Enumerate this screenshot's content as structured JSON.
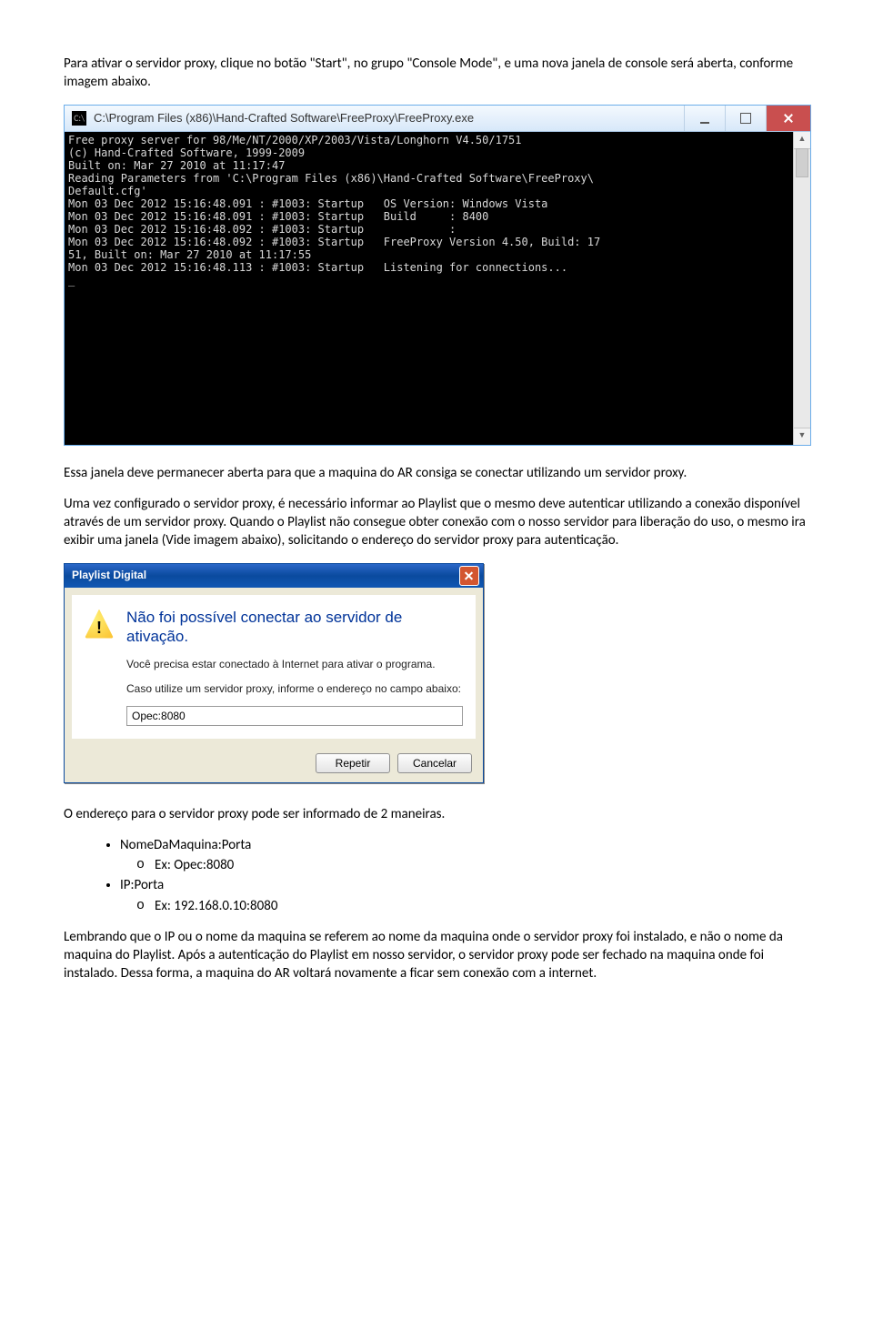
{
  "para1": "Para ativar o servidor proxy, clique no botão \"Start\", no grupo \"Console Mode\", e uma nova janela de console será aberta, conforme imagem abaixo.",
  "console": {
    "title": "C:\\Program Files (x86)\\Hand-Crafted Software\\FreeProxy\\FreeProxy.exe",
    "lines": "Free proxy server for 98/Me/NT/2000/XP/2003/Vista/Longhorn V4.50/1751\n(c) Hand-Crafted Software, 1999-2009\nBuilt on: Mar 27 2010 at 11:17:47\nReading Parameters from 'C:\\Program Files (x86)\\Hand-Crafted Software\\FreeProxy\\\nDefault.cfg'\nMon 03 Dec 2012 15:16:48.091 : #1003: Startup   OS Version: Windows Vista\nMon 03 Dec 2012 15:16:48.091 : #1003: Startup   Build     : 8400\nMon 03 Dec 2012 15:16:48.092 : #1003: Startup             :\nMon 03 Dec 2012 15:16:48.092 : #1003: Startup   FreeProxy Version 4.50, Build: 17\n51, Built on: Mar 27 2010 at 11:17:55\nMon 03 Dec 2012 15:16:48.113 : #1003: Startup   Listening for connections...\n_"
  },
  "para2": "Essa janela deve permanecer aberta para que a maquina do AR consiga se conectar utilizando um servidor proxy.",
  "para3": "Uma vez configurado o servidor proxy, é necessário informar ao Playlist que o mesmo deve autenticar utilizando a conexão disponível através de um servidor proxy. Quando o Playlist não consegue obter conexão com o nosso servidor para liberação do uso, o mesmo ira exibir uma janela (Vide imagem abaixo), solicitando o endereço do servidor proxy para autenticação.",
  "dialog": {
    "title": "Playlist Digital",
    "heading": "Não foi possível conectar ao servidor de ativação.",
    "text1": "Você precisa estar conectado à Internet para ativar o programa.",
    "text2": "Caso utilize um servidor proxy, informe o endereço no campo abaixo:",
    "input_value": "Opec:8080",
    "btn_repetir": "Repetir",
    "btn_cancelar": "Cancelar"
  },
  "para4": "O endereço para o servidor proxy pode ser informado de 2 maneiras.",
  "list": {
    "item1": "NomeDaMaquina:Porta",
    "item1_ex": "Ex: Opec:8080",
    "item2": "IP:Porta",
    "item2_ex": "Ex: 192.168.0.10:8080"
  },
  "para5": "Lembrando que o IP ou o nome da maquina se referem ao nome da maquina onde o servidor proxy foi instalado, e não o nome da maquina do Playlist. Após a autenticação do Playlist em nosso servidor, o servidor proxy pode ser fechado na maquina onde foi instalado. Dessa forma, a maquina do AR voltará novamente a ficar sem conexão com a internet."
}
